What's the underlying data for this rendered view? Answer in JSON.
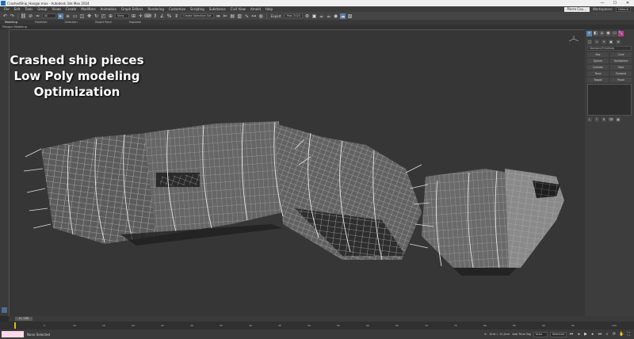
{
  "titlebar": {
    "title": "CrashedShip_Hangar.max - Autodesk 3ds Max 2024",
    "minimize": "—",
    "maximize": "☐",
    "close": "✕"
  },
  "menu": [
    "File",
    "Edit",
    "Tools",
    "Group",
    "Views",
    "Create",
    "Modifiers",
    "Animation",
    "Graph Editors",
    "Rendering",
    "Customize",
    "Scripting",
    "Substance",
    "Civil View",
    "Arnold",
    "Help"
  ],
  "menu_right": {
    "user": "Pierre Cou...",
    "workspace_label": "Workspaces:",
    "workspace_value": "Default"
  },
  "toolbar": {
    "selection_filter": "All",
    "view_dropdown": "View",
    "named_sel": "Create Selection Set",
    "export_label": "Export",
    "render_preset": "Max 2024"
  },
  "ribbon": {
    "tabs": [
      "Modeling",
      "Freeform",
      "Selection",
      "Object Paint",
      "Populate"
    ],
    "sub": "Polygon Modeling"
  },
  "viewport": {
    "label": "[+] [Perspective] [Standard] [Edged Faces]",
    "title": "Title"
  },
  "overlay": {
    "line1": "Crashed ship pieces",
    "line2": "Low Poly modeling",
    "line3": "Optimization"
  },
  "cmdpanel": {
    "tabs": [
      "+",
      "◧",
      "⌂",
      "◉",
      "▭",
      "🔧"
    ],
    "dropdown": "Standard Primitives",
    "buttons": [
      "Box",
      "Cone",
      "Sphere",
      "GeoSphere",
      "Cylinder",
      "Tube",
      "Torus",
      "Pyramid",
      "Teapot",
      "Plane"
    ]
  },
  "timeslider": {
    "value": "0 / 100"
  },
  "track_ticks": [
    "0",
    "5",
    "10",
    "15",
    "20",
    "25",
    "30",
    "35",
    "40",
    "45",
    "50",
    "55",
    "60",
    "65",
    "70",
    "75",
    "80",
    "85",
    "90",
    "95",
    "100"
  ],
  "status": {
    "text": "None Selected",
    "x": "X:",
    "grid": "Grid = 10,0cm",
    "add_time_tag": "Add Time Tag",
    "auto_label": "Auto",
    "selected": "Selected"
  }
}
